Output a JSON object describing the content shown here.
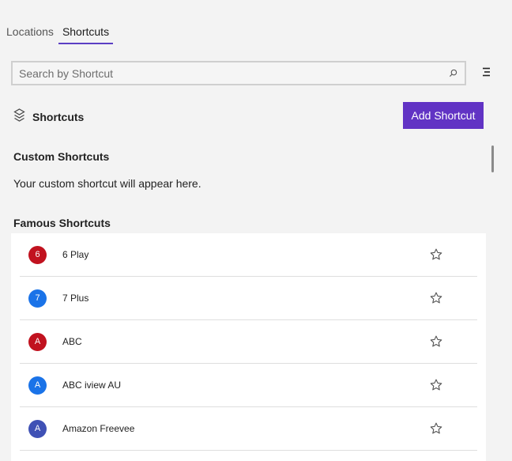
{
  "tabs": [
    {
      "label": "Locations"
    },
    {
      "label": "Shortcuts"
    }
  ],
  "search": {
    "placeholder": "Search by Shortcut",
    "value": ""
  },
  "section": {
    "title": "Shortcuts"
  },
  "add_button": {
    "label": "Add Shortcut"
  },
  "custom": {
    "title": "Custom Shortcuts",
    "empty_text": "Your custom shortcut will appear here."
  },
  "famous": {
    "title": "Famous Shortcuts",
    "items": [
      {
        "initial": "6",
        "name": "6 Play",
        "color": "#c1121f"
      },
      {
        "initial": "7",
        "name": "7 Plus",
        "color": "#1a73e8"
      },
      {
        "initial": "A",
        "name": "ABC",
        "color": "#c1121f"
      },
      {
        "initial": "A",
        "name": "ABC iview AU",
        "color": "#1a73e8"
      },
      {
        "initial": "A",
        "name": "Amazon Freevee",
        "color": "#3f51b5"
      }
    ]
  },
  "colors": {
    "accent": "#6133c4",
    "tab_underline": "#5b3ec4"
  },
  "icons": {
    "search": "search-icon",
    "menu": "menu-icon",
    "shortcuts": "shortcuts-icon",
    "favorite": "star-outline-icon"
  }
}
